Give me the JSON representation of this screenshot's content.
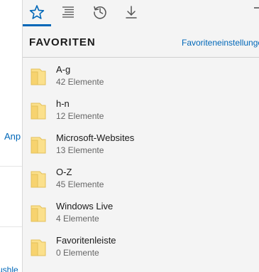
{
  "background_page": {
    "link_fragment_1": "Anp",
    "link_fragment_2": "ushle"
  },
  "hub": {
    "tabs": [
      {
        "name": "favorites",
        "icon": "star-icon",
        "active": true
      },
      {
        "name": "reading-list",
        "icon": "reading-list-icon",
        "active": false
      },
      {
        "name": "history",
        "icon": "history-icon",
        "active": false
      },
      {
        "name": "downloads",
        "icon": "download-icon",
        "active": false
      }
    ],
    "title": "FAVORITEN",
    "settings_link": "Favoriteneinstellungen",
    "folders": [
      {
        "name": "A-g",
        "count": "42 Elemente"
      },
      {
        "name": "h-n",
        "count": "12 Elemente"
      },
      {
        "name": "Microsoft-Websites",
        "count": "13 Elemente"
      },
      {
        "name": "O-Z",
        "count": "45 Elemente"
      },
      {
        "name": "Windows Live",
        "count": "4 Elemente"
      },
      {
        "name": "Favoritenleiste",
        "count": "0 Elemente"
      }
    ]
  },
  "colors": {
    "accent": "#0067b8",
    "folder_fill": "#fbe08c",
    "folder_edge": "#e3c05a",
    "panel_bg": "#f4f4f4"
  }
}
